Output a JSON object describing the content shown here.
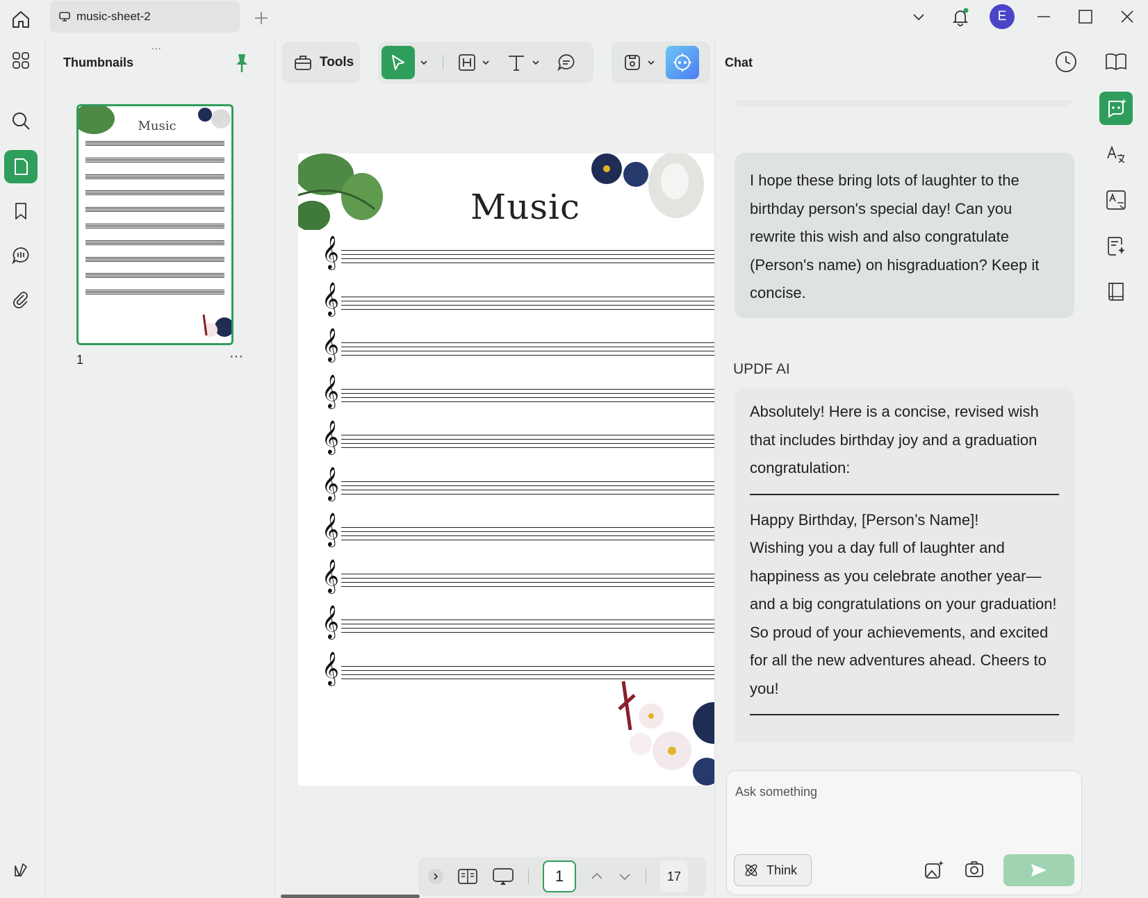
{
  "titlebar": {
    "tab_title": "music-sheet-2",
    "avatar_letter": "E"
  },
  "thumbnails": {
    "title": "Thumbnails",
    "drag_handle": "...",
    "pages": [
      {
        "number": "1",
        "more": "···",
        "title": "Music"
      }
    ]
  },
  "toolbar": {
    "tools_label": "Tools"
  },
  "document": {
    "title": "Music",
    "staff_count": 10,
    "clef_glyph": "𝄞"
  },
  "page_nav": {
    "current_page": "1",
    "total_pages": "17"
  },
  "chat": {
    "title": "Chat",
    "user_message": "I hope these bring lots of laughter to the birthday person's special day! Can you rewrite this wish and also congratulate (Person's name) on hisgraduation? Keep it concise.",
    "ai_label": "UPDF AI",
    "ai_intro": "Absolutely! Here is a concise, revised wish that includes birthday joy and a graduation congratulation:",
    "ai_wish_line1": "Happy Birthday, [Person’s Name]!",
    "ai_wish_line2": "Wishing you a day full of laughter and happiness as you celebrate another year—and a big congratulations on your graduation! So proud of your achievements, and excited for all the new adventures ahead. Cheers to you!",
    "input_placeholder": "Ask something",
    "think_label": "Think"
  },
  "colors": {
    "accent": "#2f9e5c",
    "avatar": "#4a44c9",
    "send_disabled": "#9fd3b2"
  }
}
